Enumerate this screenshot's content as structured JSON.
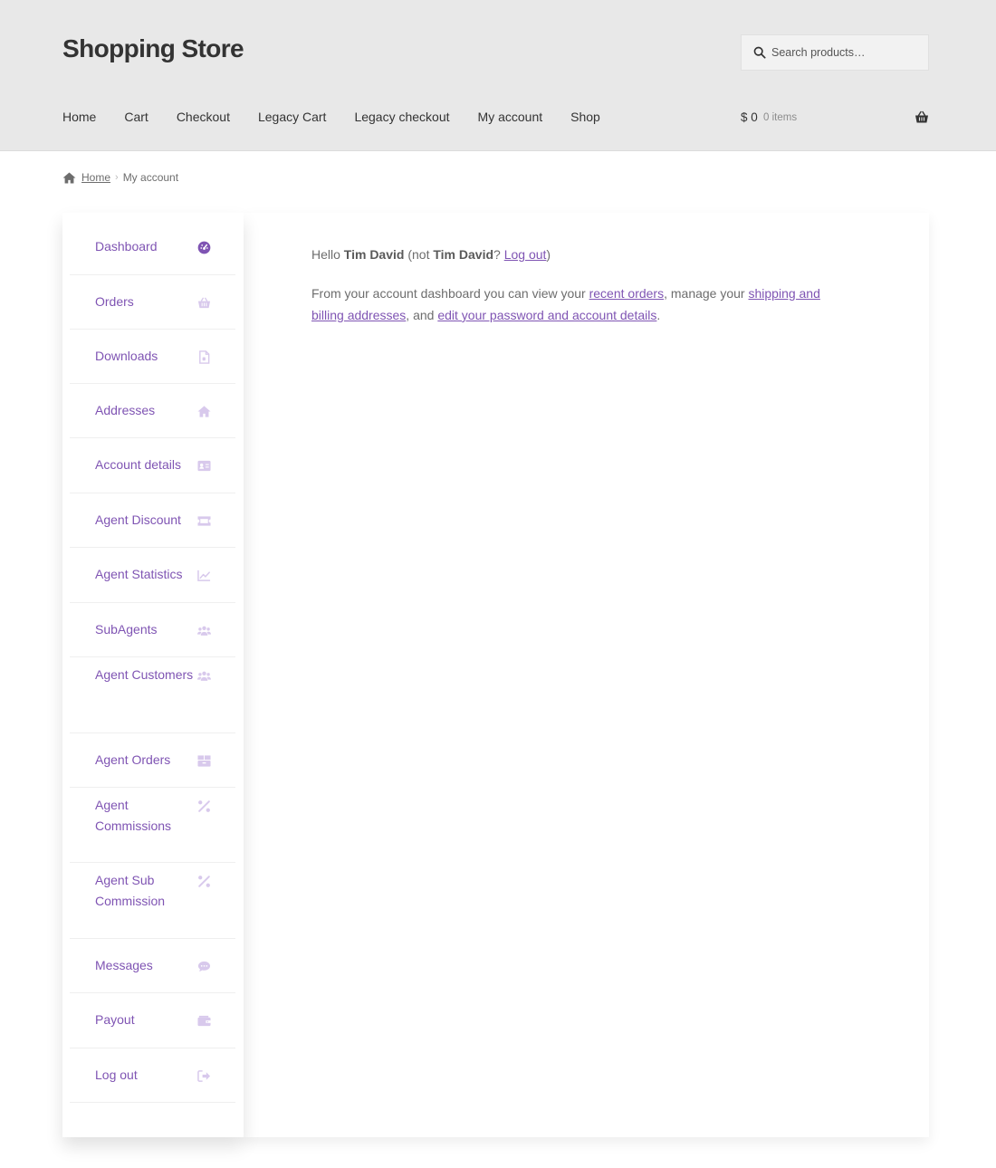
{
  "site": {
    "title": "Shopping Store"
  },
  "search": {
    "placeholder": "Search products…"
  },
  "nav": [
    "Home",
    "Cart",
    "Checkout",
    "Legacy Cart",
    "Legacy checkout",
    "My account",
    "Shop"
  ],
  "cart": {
    "amount": "$ 0",
    "count": "0 items"
  },
  "breadcrumb": {
    "home": "Home",
    "separator": "›",
    "current": "My account"
  },
  "account_nav": [
    {
      "label": "Dashboard",
      "icon": "dashboard-icon",
      "active": true
    },
    {
      "label": "Orders",
      "icon": "basket-icon"
    },
    {
      "label": "Downloads",
      "icon": "file-icon"
    },
    {
      "label": "Addresses",
      "icon": "home-icon"
    },
    {
      "label": "Account details",
      "icon": "id-card-icon"
    },
    {
      "label": "Agent Discount",
      "icon": "ticket-icon"
    },
    {
      "label": "Agent Statistics",
      "icon": "chart-line-icon"
    },
    {
      "label": "SubAgents",
      "icon": "users-icon"
    },
    {
      "label": "Agent Customers",
      "icon": "users-icon"
    },
    {
      "label": "Agent Orders",
      "icon": "boxes-icon"
    },
    {
      "label": "Agent Commissions",
      "icon": "percent-icon"
    },
    {
      "label": "Agent Sub Commission",
      "icon": "percent-icon"
    },
    {
      "label": "Messages",
      "icon": "comment-icon"
    },
    {
      "label": "Payout",
      "icon": "wallet-icon"
    },
    {
      "label": "Log out",
      "icon": "sign-out-icon"
    }
  ],
  "dashboard": {
    "hello": "Hello",
    "user": "Tim David",
    "not_prefix": "(not",
    "not_user": "Tim David",
    "question": "?",
    "logout_link": "Log out",
    "close_paren": ")",
    "intro": "From your account dashboard you can view your",
    "recent_orders": "recent orders",
    "manage": ", manage your",
    "addresses": "shipping and billing addresses",
    "and": ", and",
    "edit_details": "edit your password and account details",
    "end": "."
  },
  "colors": {
    "accent": "#7f54b3",
    "icon_muted": "#d8c9ec",
    "header_bg": "#e8e8e8"
  }
}
